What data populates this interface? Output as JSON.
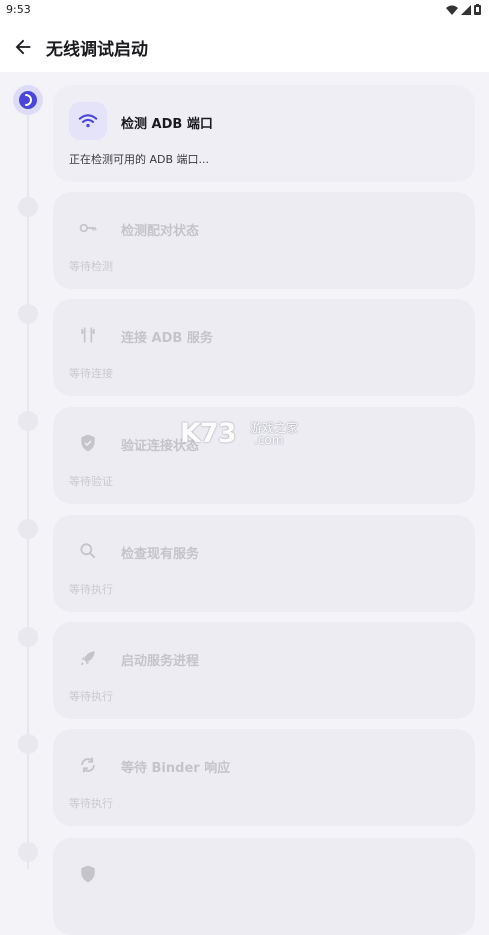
{
  "status_bar": {
    "time": "9:53",
    "icons": [
      "wifi-icon",
      "signal-icon",
      "battery-icon"
    ]
  },
  "app_bar": {
    "title": "无线调试启动",
    "back_icon": "arrow-back-icon"
  },
  "colors": {
    "accent": "#4a47d8",
    "card_bg": "#ececf2",
    "pending_text": "#c4c4ca"
  },
  "steps": [
    {
      "title": "检测 ADB 端口",
      "status": "正在检测可用的 ADB 端口...",
      "icon": "wifi-icon",
      "state": "active"
    },
    {
      "title": "检测配对状态",
      "status": "等待检测",
      "icon": "key-icon",
      "state": "pending"
    },
    {
      "title": "连接 ADB 服务",
      "status": "等待连接",
      "icon": "connect-icon",
      "state": "pending"
    },
    {
      "title": "验证连接状态",
      "status": "等待验证",
      "icon": "shield-check-icon",
      "state": "pending"
    },
    {
      "title": "检查现有服务",
      "status": "等待执行",
      "icon": "search-icon",
      "state": "pending"
    },
    {
      "title": "启动服务进程",
      "status": "等待执行",
      "icon": "rocket-icon",
      "state": "pending"
    },
    {
      "title": "等待 Binder 响应",
      "status": "等待执行",
      "icon": "sync-icon",
      "state": "pending"
    }
  ],
  "watermark": {
    "brand": "K73",
    "tagline": "游戏之家",
    "domain": ".com"
  }
}
